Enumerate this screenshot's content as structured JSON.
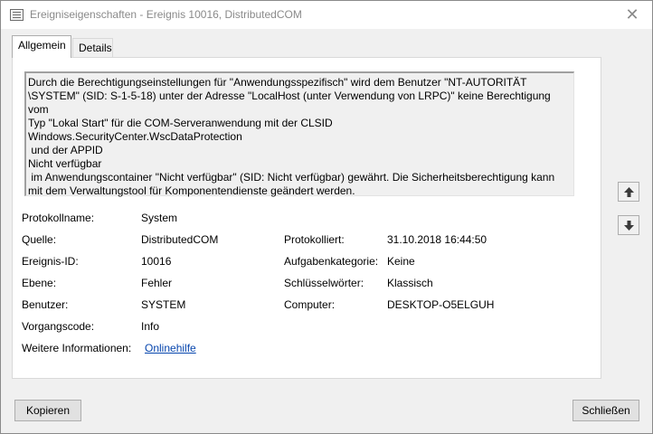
{
  "window": {
    "title": "Ereigniseigenschaften - Ereignis 10016, DistributedCOM",
    "close_glyph": "✕"
  },
  "tabs": [
    {
      "label": "Allgemein",
      "active": true
    },
    {
      "label": "Details",
      "active": false
    }
  ],
  "message": "Durch die Berechtigungseinstellungen für \"Anwendungsspezifisch\" wird dem Benutzer \"NT-AUTORITÄT\n\\SYSTEM\" (SID: S-1-5-18) unter der Adresse \"LocalHost (unter Verwendung von LRPC)\" keine Berechtigung vom\nTyp \"Lokal Start\" für die COM-Serveranwendung mit der CLSID\nWindows.SecurityCenter.WscDataProtection\n und der APPID\nNicht verfügbar\n im Anwendungscontainer \"Nicht verfügbar\" (SID: Nicht verfügbar) gewährt. Die Sicherheitsberechtigung kann\nmit dem Verwaltungstool für Komponentendienste geändert werden.",
  "fields": {
    "protokollname_label": "Protokollname:",
    "protokollname_value": "System",
    "quelle_label": "Quelle:",
    "quelle_value": "DistributedCOM",
    "protokolliert_label": "Protokolliert:",
    "protokolliert_value": "31.10.2018 16:44:50",
    "ereignis_id_label": "Ereignis-ID:",
    "ereignis_id_value": "10016",
    "aufgabenkategorie_label": "Aufgabenkategorie:",
    "aufgabenkategorie_value": "Keine",
    "ebene_label": "Ebene:",
    "ebene_value": "Fehler",
    "schluesselwoerter_label": "Schlüsselwörter:",
    "schluesselwoerter_value": "Klassisch",
    "benutzer_label": "Benutzer:",
    "benutzer_value": "SYSTEM",
    "computer_label": "Computer:",
    "computer_value": "DESKTOP-O5ELGUH",
    "vorgangscode_label": "Vorgangscode:",
    "vorgangscode_value": "Info",
    "weitere_label": "Weitere Informationen:",
    "weitere_link": "Onlinehilfe"
  },
  "buttons": {
    "copy": "Kopieren",
    "close": "Schließen"
  },
  "icons": {
    "up": "arrow-up-icon",
    "down": "arrow-down-icon"
  }
}
